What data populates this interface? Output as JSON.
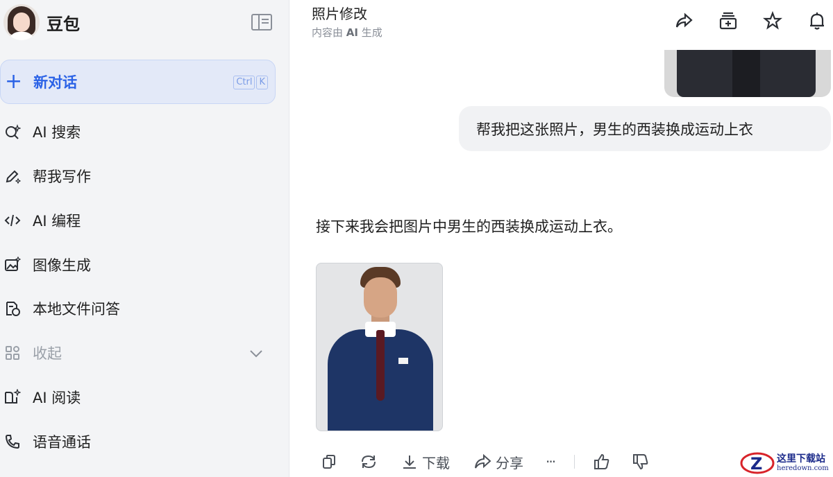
{
  "sidebar": {
    "brand_name": "豆包",
    "new_chat": {
      "label": "新对话",
      "shortcut_keys": [
        "Ctrl",
        "K"
      ]
    },
    "items": [
      {
        "label": "AI 搜索",
        "icon": "ai-search-icon"
      },
      {
        "label": "帮我写作",
        "icon": "pen-sparkle-icon"
      },
      {
        "label": "AI 编程",
        "icon": "code-icon"
      },
      {
        "label": "图像生成",
        "icon": "image-sparkle-icon"
      },
      {
        "label": "本地文件问答",
        "icon": "file-chat-icon"
      },
      {
        "label": "收起",
        "icon": "apps-grid-icon",
        "muted": true
      },
      {
        "label": "AI 阅读",
        "icon": "book-sparkle-icon"
      },
      {
        "label": "语音通话",
        "icon": "phone-icon"
      }
    ]
  },
  "header": {
    "title": "照片修改",
    "subtitle_prefix": "内容由 ",
    "subtitle_bold": "AI",
    "subtitle_suffix": " 生成",
    "icons": [
      "share-icon",
      "add-to-collection-icon",
      "star-icon",
      "bell-icon"
    ]
  },
  "chat": {
    "user_message": "帮我把这张照片，男生的西装换成运动上衣",
    "assistant_reply": "接下来我会把图片中男生的西装换成运动上衣。"
  },
  "actions": {
    "download_label": "下载",
    "share_label": "分享",
    "more_label": "···"
  },
  "watermark": {
    "cn": "这里下载站",
    "en": "heredown.com"
  },
  "colors": {
    "accent": "#2b62e6",
    "sidebar_bg": "#f3f4f6",
    "new_chat_bg": "#e3e9f8",
    "bubble_bg": "#f1f2f4"
  }
}
